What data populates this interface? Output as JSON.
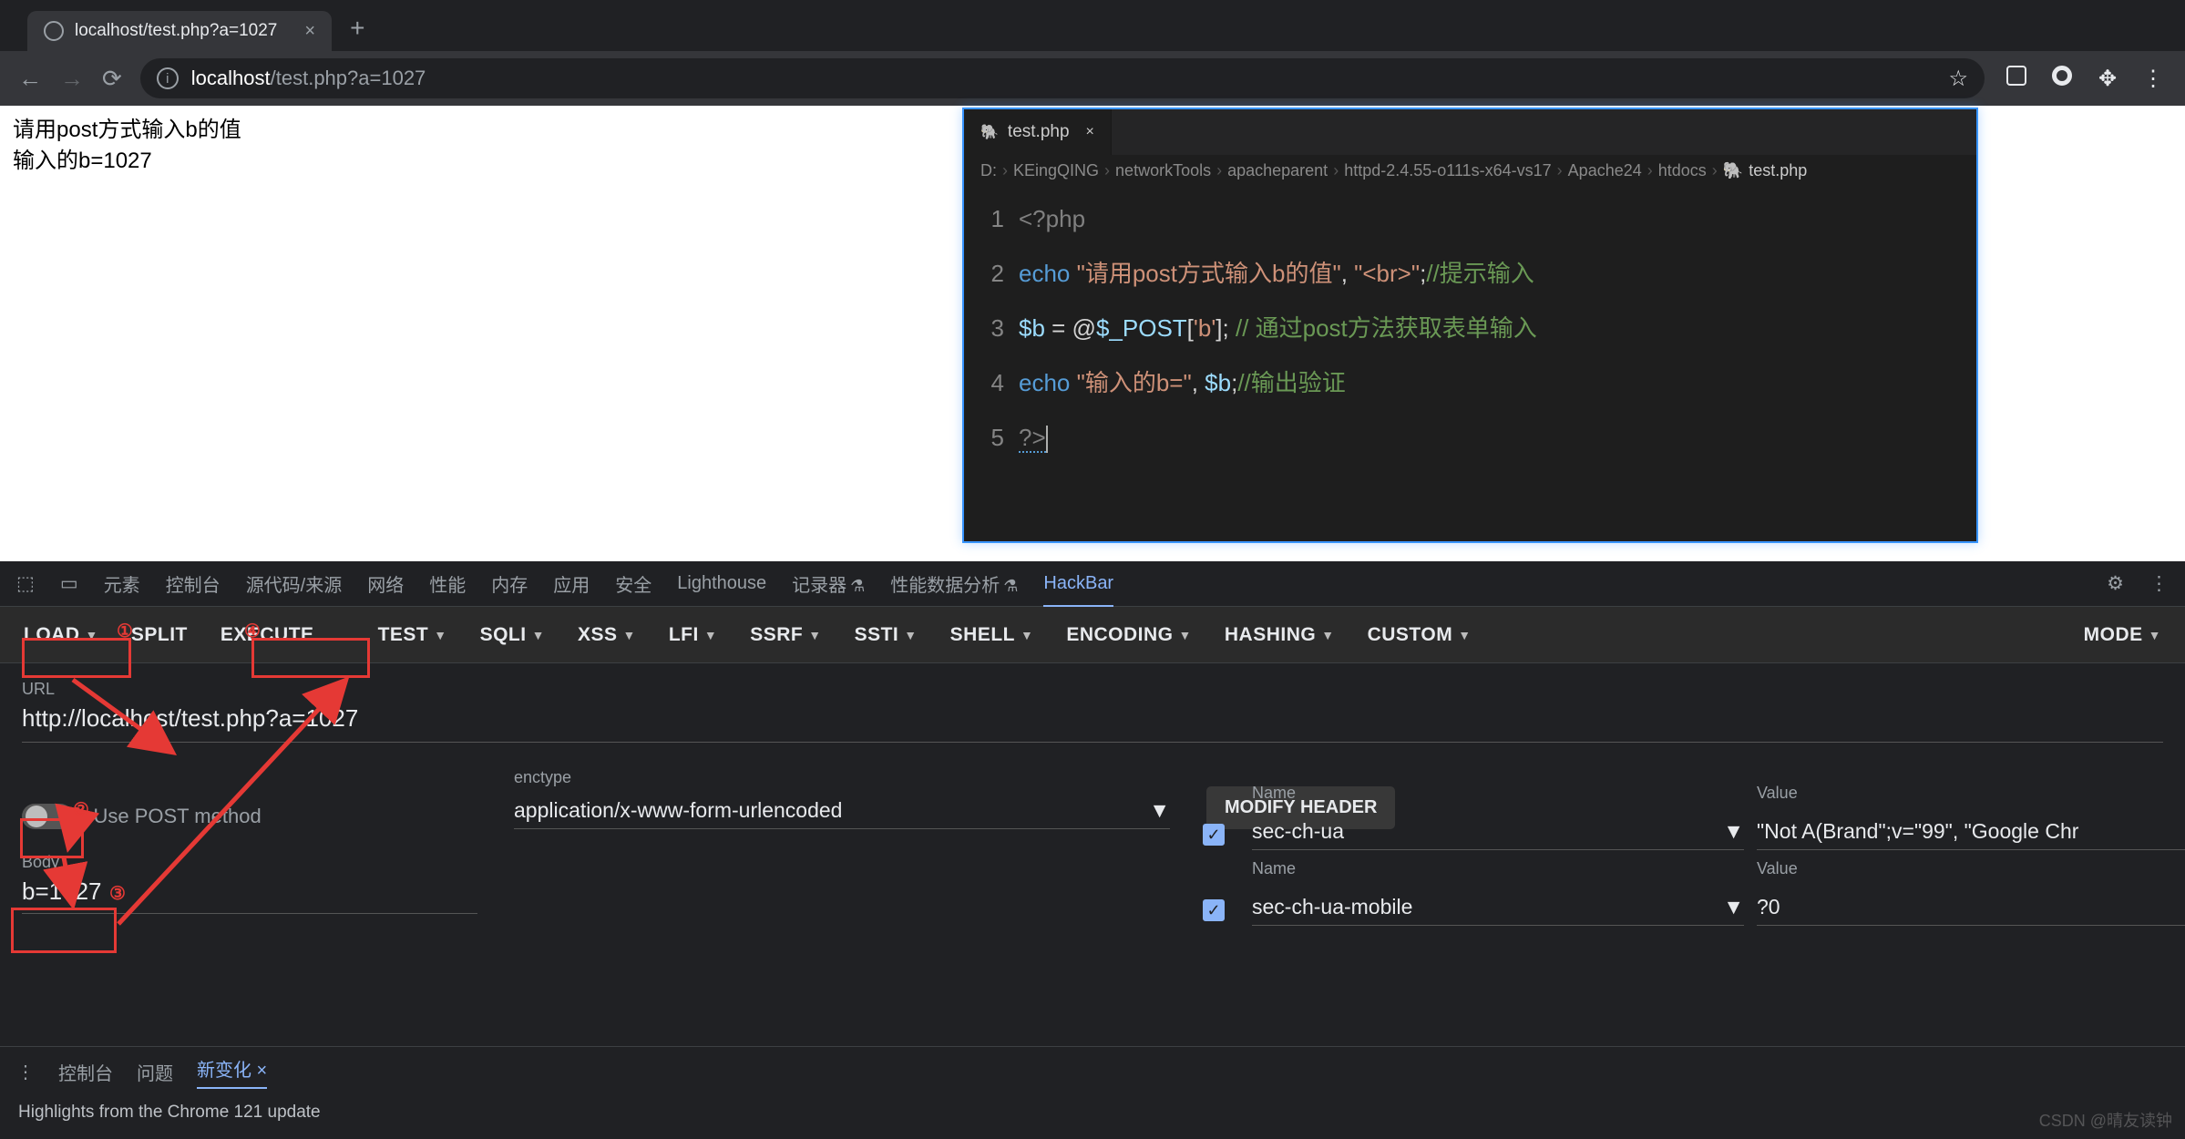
{
  "browser": {
    "tab_title": "localhost/test.php?a=1027",
    "url_display_host": "localhost",
    "url_display_path": "/test.php?a=1027",
    "star": "☆"
  },
  "page": {
    "line1": "请用post方式输入b的值",
    "line2": "输入的b=1027"
  },
  "editor": {
    "tab": "test.php",
    "breadcrumbs": [
      "D:",
      "KEingQING",
      "networkTools",
      "apacheparent",
      "httpd-2.4.55-o111s-x64-vs17",
      "Apache24",
      "htdocs",
      "test.php"
    ],
    "lines": {
      "l1": "<?php",
      "l2_a": "echo ",
      "l2_s1": "\"请用post方式输入b的值\"",
      "l2_b": ", ",
      "l2_s2": "\"<br>\"",
      "l2_c": ";",
      "l2_cmt": "//提示输入",
      "l3_a": "$b",
      "l3_b": " = @",
      "l3_c": "$_POST",
      "l3_d": "[",
      "l3_s": "'b'",
      "l3_e": "]; ",
      "l3_cmt": "// 通过post方法获取表单输入",
      "l4_a": "echo ",
      "l4_s": "\"输入的b=\"",
      "l4_b": ", ",
      "l4_c": "$b",
      "l4_d": ";",
      "l4_cmt": "//输出验证",
      "l5": "?>"
    }
  },
  "devtools": {
    "tabs": [
      "元素",
      "控制台",
      "源代码/来源",
      "网络",
      "性能",
      "内存",
      "应用",
      "安全",
      "Lighthouse",
      "记录器",
      "性能数据分析",
      "HackBar"
    ],
    "console_tabs": {
      "a": "控制台",
      "b": "问题",
      "c": "新变化"
    },
    "hint": "Highlights from the Chrome 121 update"
  },
  "hackbar": {
    "buttons": {
      "load": "LOAD",
      "split": "SPLIT",
      "execute": "EXECUTE",
      "test": "TEST",
      "sqli": "SQLI",
      "xss": "XSS",
      "lfi": "LFI",
      "ssrf": "SSRF",
      "ssti": "SSTI",
      "shell": "SHELL",
      "encoding": "ENCODING",
      "hashing": "HASHING",
      "custom": "CUSTOM",
      "mode": "MODE"
    },
    "url_label": "URL",
    "url": "http://localhost/test.php?a=1027",
    "use_post": "Use POST method",
    "enctype_label": "enctype",
    "enctype": "application/x-www-form-urlencoded",
    "modify_header": "MODIFY HEADER",
    "body_label": "Body",
    "body": "b=1027",
    "headers": [
      {
        "name_label": "Name",
        "name": "sec-ch-ua",
        "value_label": "Value",
        "value": "\"Not A(Brand\";v=\"99\", \"Google Chr"
      },
      {
        "name_label": "Name",
        "name": "sec-ch-ua-mobile",
        "value_label": "Value",
        "value": "?0"
      }
    ]
  },
  "watermark": "CSDN @晴友读钟"
}
